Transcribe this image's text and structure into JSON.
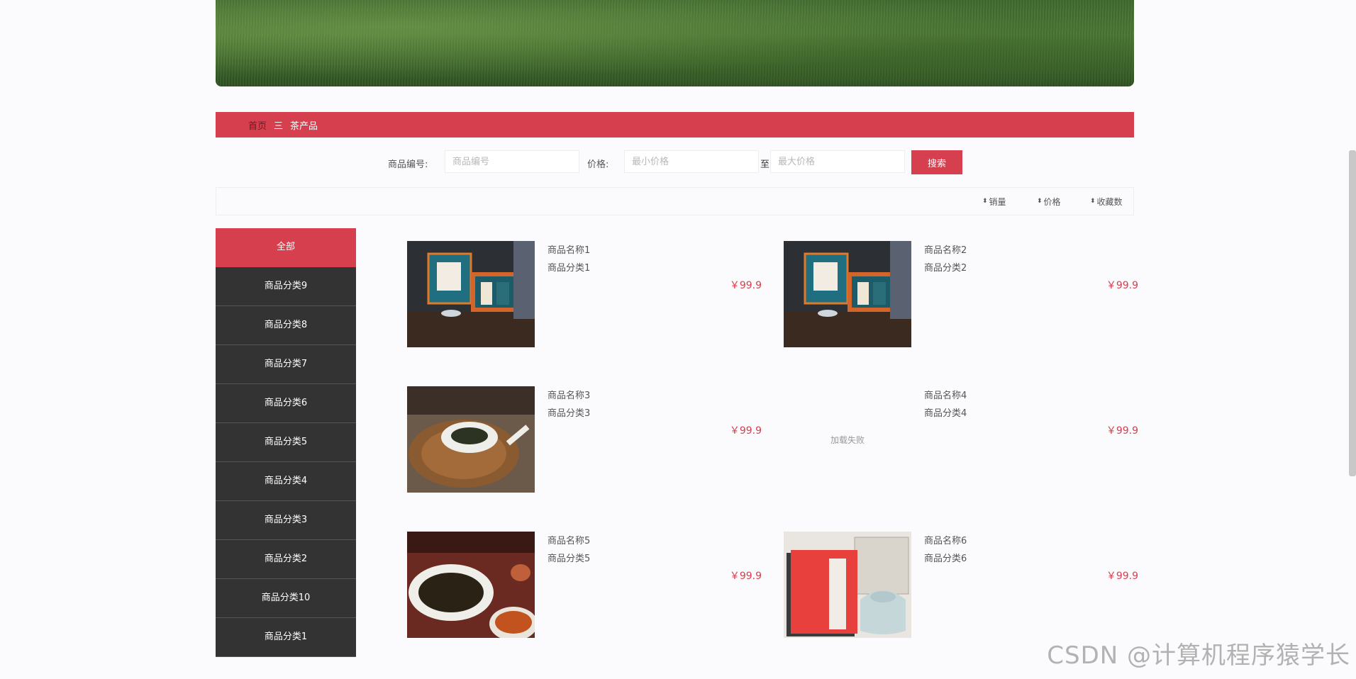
{
  "breadcrumb": {
    "home": "首页",
    "separator": "三",
    "current": "茶产品"
  },
  "search": {
    "code_label": "商品编号:",
    "code_placeholder": "商品编号",
    "price_label": "价格:",
    "min_placeholder": "最小价格",
    "to": "至",
    "max_placeholder": "最大价格",
    "button": "搜索"
  },
  "sort": {
    "sales": "销量",
    "price": "价格",
    "favorites": "收藏数"
  },
  "categories": [
    "全部",
    "商品分类9",
    "商品分类8",
    "商品分类7",
    "商品分类6",
    "商品分类5",
    "商品分类4",
    "商品分类3",
    "商品分类2",
    "商品分类10",
    "商品分类1"
  ],
  "products": [
    {
      "name": "商品名称1",
      "category": "商品分类1",
      "price": "￥99.9"
    },
    {
      "name": "商品名称2",
      "category": "商品分类2",
      "price": "￥99.9"
    },
    {
      "name": "商品名称3",
      "category": "商品分类3",
      "price": "￥99.9"
    },
    {
      "name": "商品名称4",
      "category": "商品分类4",
      "price": "￥99.9",
      "image_text": "加载失败"
    },
    {
      "name": "商品名称5",
      "category": "商品分类5",
      "price": "￥99.9"
    },
    {
      "name": "商品名称6",
      "category": "商品分类6",
      "price": "￥99.9"
    }
  ],
  "watermark": "CSDN @计算机程序猿学长",
  "colors": {
    "accent": "#d6404e",
    "sidebar": "#333333"
  }
}
